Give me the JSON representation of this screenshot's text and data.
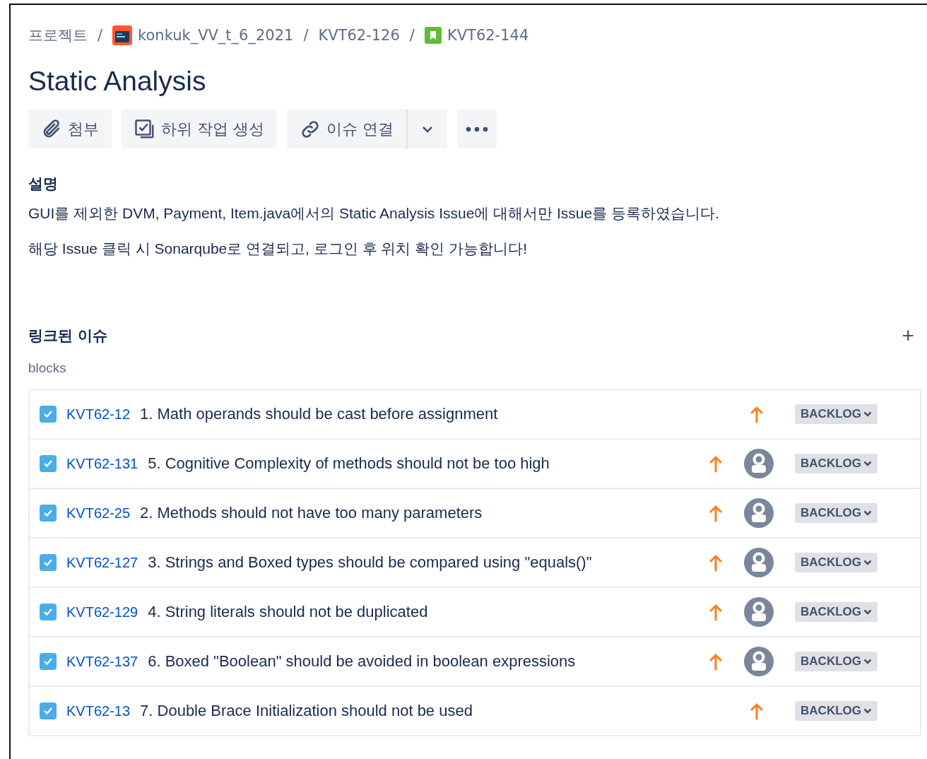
{
  "breadcrumb_separator": "/",
  "breadcrumbs": [
    {
      "kind": "text",
      "label": "프로젝트"
    },
    {
      "kind": "project",
      "label": "konkuk_VV_t_6_2021"
    },
    {
      "kind": "text",
      "label": "KVT62-126"
    },
    {
      "kind": "story",
      "label": "KVT62-144"
    }
  ],
  "title": "Static Analysis",
  "actions": [
    {
      "kind": "attach",
      "label": "첨부"
    },
    {
      "kind": "subtask",
      "label": "하위 작업 생성"
    },
    {
      "kind": "link",
      "label": "이슈 연결"
    },
    {
      "kind": "caret"
    },
    {
      "kind": "more"
    }
  ],
  "description": {
    "heading": "설명",
    "paragraphs": [
      "GUI를 제외한 DVM, Payment, Item.java에서의 Static Analysis Issue에 대해서만 Issue를 등록하였습니다.",
      "해당 Issue 클릭 시 Sonarqube로 연결되고, 로그인 후 위치 확인 가능합니다!"
    ]
  },
  "linked_issues": {
    "heading": "링크된 이슈",
    "add": "+",
    "relation": "blocks",
    "rows": [
      {
        "key": "KVT62-12",
        "summary": "1. Math operands should be cast before assignment",
        "checked": true,
        "assigned": false,
        "status": "BACKLOG"
      },
      {
        "key": "KVT62-131",
        "summary": "5. Cognitive Complexity of methods should not be too high",
        "checked": true,
        "assigned": true,
        "status": "BACKLOG"
      },
      {
        "key": "KVT62-25",
        "summary": "2. Methods should not have too many parameters",
        "checked": true,
        "assigned": true,
        "status": "BACKLOG"
      },
      {
        "key": "KVT62-127",
        "summary": "3. Strings and Boxed types should be compared using \"equals()\"",
        "checked": true,
        "assigned": true,
        "status": "BACKLOG"
      },
      {
        "key": "KVT62-129",
        "summary": "4. String literals should not be duplicated",
        "checked": true,
        "assigned": true,
        "status": "BACKLOG"
      },
      {
        "key": "KVT62-137",
        "summary": "6. Boxed \"Boolean\" should be avoided in boolean expressions",
        "checked": true,
        "assigned": true,
        "status": "BACKLOG"
      },
      {
        "key": "KVT62-13",
        "summary": "7. Double Brace Initialization should not be used",
        "checked": true,
        "assigned": false,
        "status": "BACKLOG"
      }
    ]
  }
}
